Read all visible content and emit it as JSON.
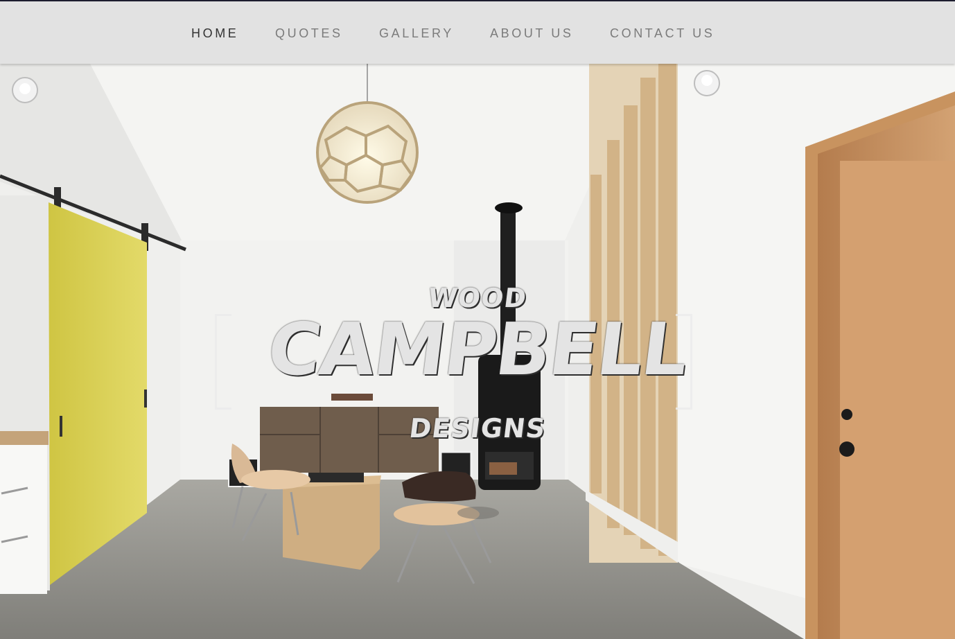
{
  "nav": {
    "items": [
      {
        "label": "HOME",
        "active": true
      },
      {
        "label": "QUOTES",
        "active": false
      },
      {
        "label": "GALLERY",
        "active": false
      },
      {
        "label": "ABOUT US",
        "active": false
      },
      {
        "label": "CONTACT US",
        "active": false
      }
    ]
  },
  "hero": {
    "logo": {
      "top_word": "WOOD",
      "main_word": "CAMPBELL",
      "bottom_word": "DESIGNS"
    },
    "image_description_icon": "interior-photo"
  },
  "colors": {
    "nav_background": "#e2e2e2",
    "nav_text": "#7b7b7b",
    "nav_text_active": "#333333",
    "logo_text": "#e4e4e4",
    "barn_door": "#d9cf4f",
    "wood_slats": "#d6b98e",
    "door": "#c28a5a",
    "floor": "#8f8e88"
  }
}
